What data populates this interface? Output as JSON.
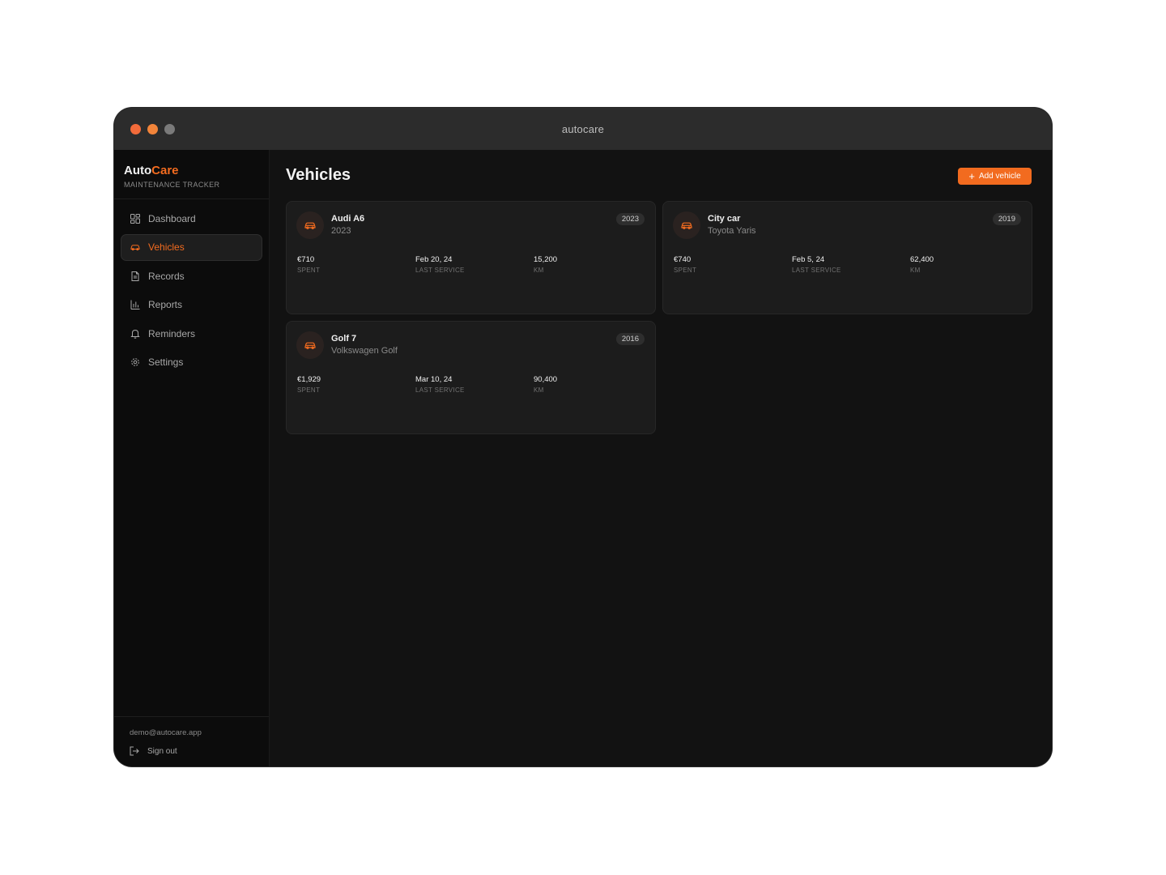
{
  "window": {
    "title": "autocare"
  },
  "sidebar": {
    "brand": {
      "name_primary": "Auto",
      "name_accent": "Care",
      "subtitle": "MAINTENANCE TRACKER"
    },
    "items": [
      {
        "label": "Dashboard",
        "icon": "dashboard-icon",
        "active": false
      },
      {
        "label": "Vehicles",
        "icon": "car-icon",
        "active": true
      },
      {
        "label": "Records",
        "icon": "document-icon",
        "active": false
      },
      {
        "label": "Reports",
        "icon": "bar-chart-icon",
        "active": false
      },
      {
        "label": "Reminders",
        "icon": "bell-icon",
        "active": false
      },
      {
        "label": "Settings",
        "icon": "gear-icon",
        "active": false
      }
    ],
    "footer": {
      "email": "demo@autocare.app",
      "signout_label": "Sign out"
    }
  },
  "main": {
    "title": "Vehicles",
    "add_button_label": "Add vehicle",
    "vehicles": [
      {
        "name": "Audi A6",
        "subtitle": "2023",
        "year": "2023",
        "spent": "€710",
        "spent_label": "SPENT",
        "last_service": "Feb 20, 24",
        "last_service_label": "LAST SERVICE",
        "km": "15,200",
        "km_label": "KM"
      },
      {
        "name": "City car",
        "subtitle": "Toyota Yaris",
        "year": "2019",
        "spent": "€740",
        "spent_label": "SPENT",
        "last_service": "Feb 5, 24",
        "last_service_label": "LAST SERVICE",
        "km": "62,400",
        "km_label": "KM"
      },
      {
        "name": "Golf 7",
        "subtitle": "Volkswagen Golf",
        "year": "2016",
        "spent": "€1,929",
        "spent_label": "SPENT",
        "last_service": "Mar 10, 24",
        "last_service_label": "LAST SERVICE",
        "km": "90,400",
        "km_label": "KM"
      }
    ]
  },
  "colors": {
    "accent": "#f26b1f",
    "background": "#121212",
    "sidebar": "#0c0c0c",
    "card": "#1c1c1c"
  }
}
